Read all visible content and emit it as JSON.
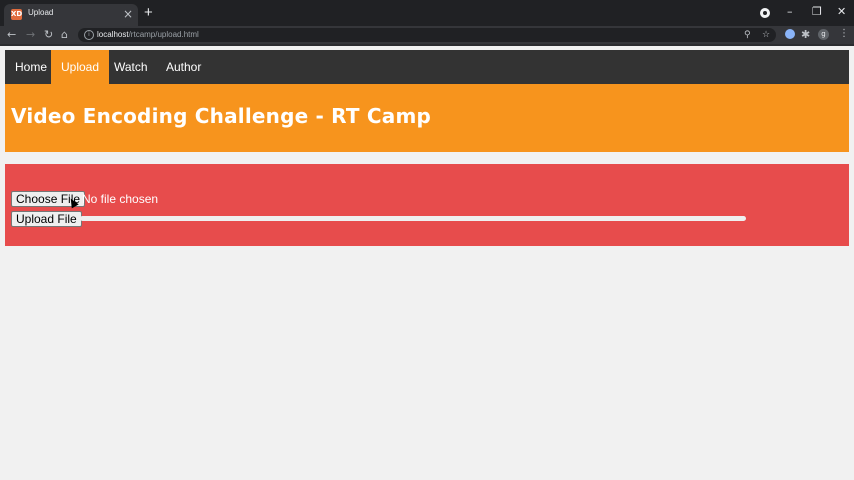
{
  "browser": {
    "tab_title": "Upload",
    "tab_favicon": "XD",
    "new_tab_label": "+",
    "address_host": "localhost",
    "address_path": "/rtcamp/upload.html",
    "avatar_letter": "g",
    "icons": [
      "back-icon",
      "forward-icon",
      "reload-icon",
      "home-icon",
      "info-icon",
      "zoom-icon",
      "star-icon",
      "extension-icon",
      "puzzle-icon",
      "menu-icon"
    ]
  },
  "nav": {
    "items": [
      {
        "label": "Home",
        "active": false
      },
      {
        "label": "Upload",
        "active": true
      },
      {
        "label": "Watch",
        "active": false
      },
      {
        "label": "Author",
        "active": false
      }
    ]
  },
  "header": {
    "title": "Video Encoding Challenge - RT Camp"
  },
  "upload": {
    "choose_file_label": "Choose File",
    "file_status": "No file chosen",
    "upload_button_label": "Upload File",
    "progress": 0
  },
  "colors": {
    "navbar": "#333333",
    "accent": "#f7941d",
    "panel": "#e74c4c",
    "page_bg": "#f1f1f1"
  }
}
